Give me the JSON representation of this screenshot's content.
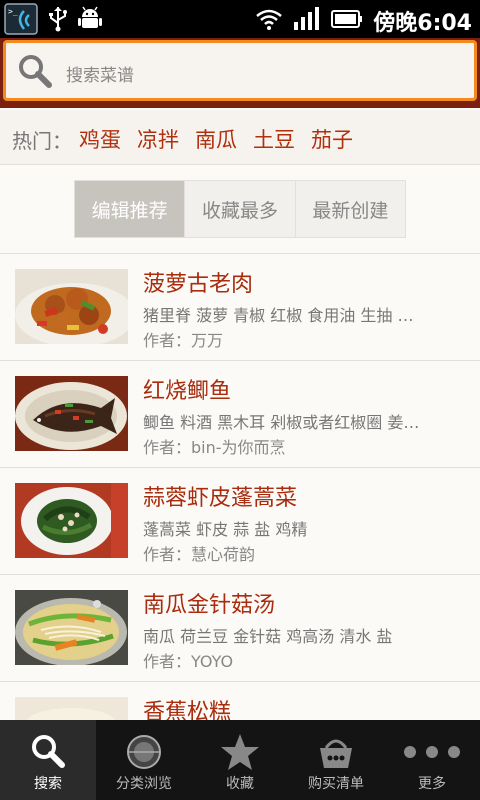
{
  "status_bar": {
    "time": "傍晚6:04"
  },
  "search": {
    "placeholder": "搜索菜谱"
  },
  "hot": {
    "label": "热门：",
    "tags": [
      "鸡蛋",
      "凉拌",
      "南瓜",
      "土豆",
      "茄子"
    ]
  },
  "tabs": [
    {
      "label": "编辑推荐",
      "active": true
    },
    {
      "label": "收藏最多",
      "active": false
    },
    {
      "label": "最新创建",
      "active": false
    }
  ],
  "recipes": [
    {
      "title": "菠萝古老肉",
      "ingredients": "猪里脊  菠萝  青椒  红椒  食用油  生抽  …",
      "author": "作者：万万"
    },
    {
      "title": "红烧鲫鱼",
      "ingredients": "鲫鱼  料酒  黑木耳  剁椒或者红椒圈  姜…",
      "author": "作者：bin-为你而烹"
    },
    {
      "title": "蒜蓉虾皮蓬蒿菜",
      "ingredients": "蓬蒿菜  虾皮  蒜  盐  鸡精",
      "author": "作者：慧心荷韵"
    },
    {
      "title": "南瓜金针菇汤",
      "ingredients": "南瓜  荷兰豆  金针菇  鸡高汤  清水  盐",
      "author": "作者：YOYO"
    },
    {
      "title": "香蕉松糕"
    }
  ],
  "nav": [
    {
      "label": "搜索",
      "icon": "search-icon",
      "active": true
    },
    {
      "label": "分类浏览",
      "icon": "category-icon",
      "active": false
    },
    {
      "label": "收藏",
      "icon": "star-icon",
      "active": false
    },
    {
      "label": "购买清单",
      "icon": "basket-icon",
      "active": false
    },
    {
      "label": "更多",
      "icon": "more-dots-icon",
      "active": false
    }
  ]
}
